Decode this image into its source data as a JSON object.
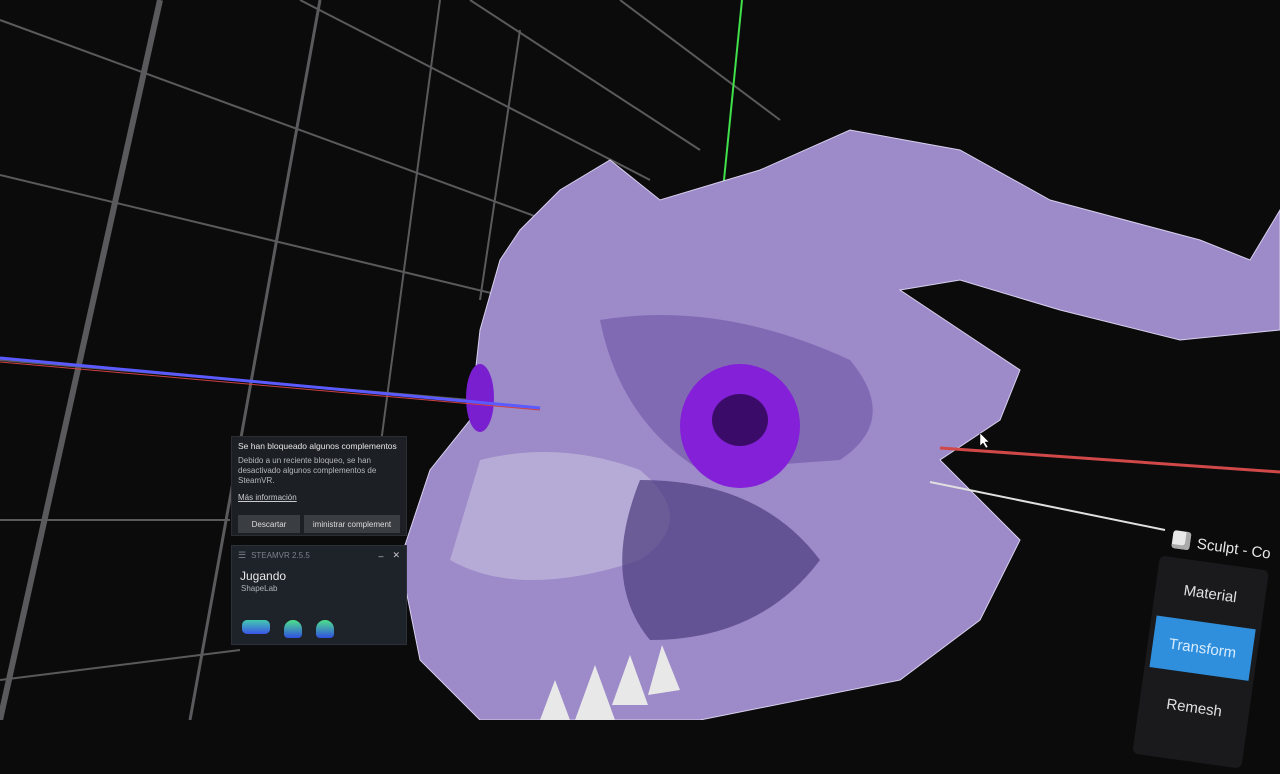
{
  "notification": {
    "title": "Se han bloqueado algunos complementos",
    "body": "Debido a un reciente bloqueo, se han desactivado algunos complementos de SteamVR.",
    "link": "Más información",
    "dismiss": "Descartar",
    "manage": "iministrar complement"
  },
  "steamvr": {
    "version": "STEAMVR 2.5.5",
    "status": "Jugando",
    "app": "ShapeLab",
    "minimize": "–",
    "close": "✕",
    "devices": [
      "headset-icon",
      "controller-icon",
      "controller-icon"
    ]
  },
  "vr_panel": {
    "title": "Sculpt - Co",
    "items": [
      "Material",
      "Transform",
      "Remesh"
    ],
    "active": "Transform"
  },
  "colors": {
    "accent": "#2f8fdc",
    "model": "#a48fd6",
    "eye": "#7a1fd0"
  }
}
